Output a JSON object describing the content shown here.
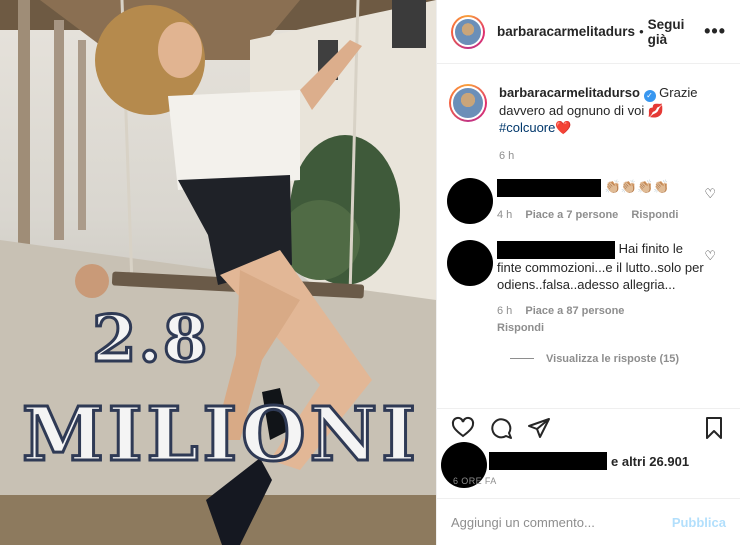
{
  "post": {
    "username": "barbaracarmelitadurso",
    "header_username": "barbaracarmelitadurs",
    "follow_label": "Segui già",
    "more_icon": "more-icon"
  },
  "image": {
    "overlay_number": "2.8",
    "overlay_word": "MILIONI"
  },
  "caption": {
    "username": "barbaracarmelitadurso",
    "text": "Grazie davvero ad ognuno di voi 💋",
    "hashtag": "#colcuore",
    "heart": "❤️",
    "time": "6 h"
  },
  "comments": [
    {
      "text": "👏🏼👏🏼👏🏼👏🏼",
      "time": "4 h",
      "likes": "Piace a 7 persone",
      "reply": "Rispondi"
    },
    {
      "text": "Hai finito le finte commozioni...e il lutto..solo per odiens..falsa..adesso allegria...",
      "time": "6 h",
      "likes": "Piace a 87 persone",
      "reply": "Rispondi",
      "view_replies": "Visualizza le risposte (15)"
    }
  ],
  "likes": {
    "text": "e altri 26.901"
  },
  "date": "6 ORE FA",
  "add_comment": {
    "placeholder": "Aggiungi un commento...",
    "publish": "Pubblica"
  },
  "colors": {
    "accent": "#3897f0",
    "publish_disabled": "#b2dffc",
    "heart": "#ed4956"
  }
}
